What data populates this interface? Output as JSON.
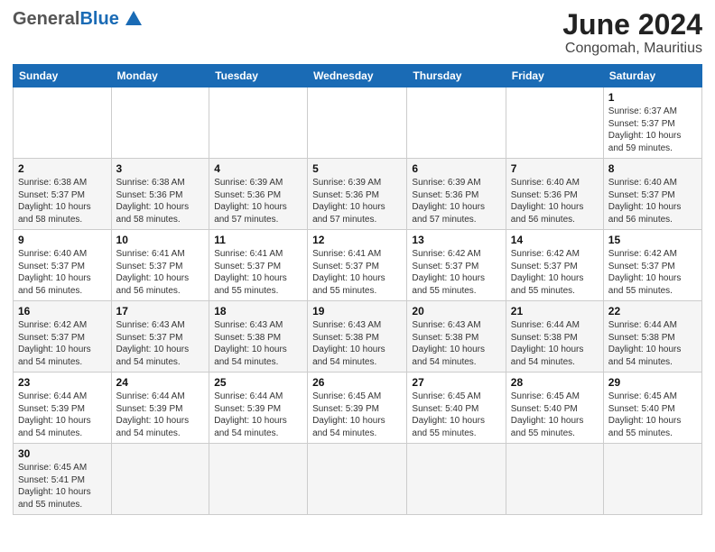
{
  "header": {
    "logo_general": "General",
    "logo_blue": "Blue",
    "month_title": "June 2024",
    "location": "Congomah, Mauritius"
  },
  "weekdays": [
    "Sunday",
    "Monday",
    "Tuesday",
    "Wednesday",
    "Thursday",
    "Friday",
    "Saturday"
  ],
  "weeks": [
    [
      {
        "day": "",
        "info": ""
      },
      {
        "day": "",
        "info": ""
      },
      {
        "day": "",
        "info": ""
      },
      {
        "day": "",
        "info": ""
      },
      {
        "day": "",
        "info": ""
      },
      {
        "day": "",
        "info": ""
      },
      {
        "day": "1",
        "info": "Sunrise: 6:37 AM\nSunset: 5:37 PM\nDaylight: 10 hours and 59 minutes."
      }
    ],
    [
      {
        "day": "2",
        "info": "Sunrise: 6:38 AM\nSunset: 5:37 PM\nDaylight: 10 hours and 58 minutes."
      },
      {
        "day": "3",
        "info": "Sunrise: 6:38 AM\nSunset: 5:36 PM\nDaylight: 10 hours and 58 minutes."
      },
      {
        "day": "4",
        "info": "Sunrise: 6:39 AM\nSunset: 5:36 PM\nDaylight: 10 hours and 57 minutes."
      },
      {
        "day": "5",
        "info": "Sunrise: 6:39 AM\nSunset: 5:36 PM\nDaylight: 10 hours and 57 minutes."
      },
      {
        "day": "6",
        "info": "Sunrise: 6:39 AM\nSunset: 5:36 PM\nDaylight: 10 hours and 57 minutes."
      },
      {
        "day": "7",
        "info": "Sunrise: 6:40 AM\nSunset: 5:36 PM\nDaylight: 10 hours and 56 minutes."
      },
      {
        "day": "8",
        "info": "Sunrise: 6:40 AM\nSunset: 5:37 PM\nDaylight: 10 hours and 56 minutes."
      }
    ],
    [
      {
        "day": "9",
        "info": "Sunrise: 6:40 AM\nSunset: 5:37 PM\nDaylight: 10 hours and 56 minutes."
      },
      {
        "day": "10",
        "info": "Sunrise: 6:41 AM\nSunset: 5:37 PM\nDaylight: 10 hours and 56 minutes."
      },
      {
        "day": "11",
        "info": "Sunrise: 6:41 AM\nSunset: 5:37 PM\nDaylight: 10 hours and 55 minutes."
      },
      {
        "day": "12",
        "info": "Sunrise: 6:41 AM\nSunset: 5:37 PM\nDaylight: 10 hours and 55 minutes."
      },
      {
        "day": "13",
        "info": "Sunrise: 6:42 AM\nSunset: 5:37 PM\nDaylight: 10 hours and 55 minutes."
      },
      {
        "day": "14",
        "info": "Sunrise: 6:42 AM\nSunset: 5:37 PM\nDaylight: 10 hours and 55 minutes."
      },
      {
        "day": "15",
        "info": "Sunrise: 6:42 AM\nSunset: 5:37 PM\nDaylight: 10 hours and 55 minutes."
      }
    ],
    [
      {
        "day": "16",
        "info": "Sunrise: 6:42 AM\nSunset: 5:37 PM\nDaylight: 10 hours and 54 minutes."
      },
      {
        "day": "17",
        "info": "Sunrise: 6:43 AM\nSunset: 5:37 PM\nDaylight: 10 hours and 54 minutes."
      },
      {
        "day": "18",
        "info": "Sunrise: 6:43 AM\nSunset: 5:38 PM\nDaylight: 10 hours and 54 minutes."
      },
      {
        "day": "19",
        "info": "Sunrise: 6:43 AM\nSunset: 5:38 PM\nDaylight: 10 hours and 54 minutes."
      },
      {
        "day": "20",
        "info": "Sunrise: 6:43 AM\nSunset: 5:38 PM\nDaylight: 10 hours and 54 minutes."
      },
      {
        "day": "21",
        "info": "Sunrise: 6:44 AM\nSunset: 5:38 PM\nDaylight: 10 hours and 54 minutes."
      },
      {
        "day": "22",
        "info": "Sunrise: 6:44 AM\nSunset: 5:38 PM\nDaylight: 10 hours and 54 minutes."
      }
    ],
    [
      {
        "day": "23",
        "info": "Sunrise: 6:44 AM\nSunset: 5:39 PM\nDaylight: 10 hours and 54 minutes."
      },
      {
        "day": "24",
        "info": "Sunrise: 6:44 AM\nSunset: 5:39 PM\nDaylight: 10 hours and 54 minutes."
      },
      {
        "day": "25",
        "info": "Sunrise: 6:44 AM\nSunset: 5:39 PM\nDaylight: 10 hours and 54 minutes."
      },
      {
        "day": "26",
        "info": "Sunrise: 6:45 AM\nSunset: 5:39 PM\nDaylight: 10 hours and 54 minutes."
      },
      {
        "day": "27",
        "info": "Sunrise: 6:45 AM\nSunset: 5:40 PM\nDaylight: 10 hours and 55 minutes."
      },
      {
        "day": "28",
        "info": "Sunrise: 6:45 AM\nSunset: 5:40 PM\nDaylight: 10 hours and 55 minutes."
      },
      {
        "day": "29",
        "info": "Sunrise: 6:45 AM\nSunset: 5:40 PM\nDaylight: 10 hours and 55 minutes."
      }
    ],
    [
      {
        "day": "30",
        "info": "Sunrise: 6:45 AM\nSunset: 5:41 PM\nDaylight: 10 hours and 55 minutes."
      },
      {
        "day": "",
        "info": ""
      },
      {
        "day": "",
        "info": ""
      },
      {
        "day": "",
        "info": ""
      },
      {
        "day": "",
        "info": ""
      },
      {
        "day": "",
        "info": ""
      },
      {
        "day": "",
        "info": ""
      }
    ]
  ]
}
